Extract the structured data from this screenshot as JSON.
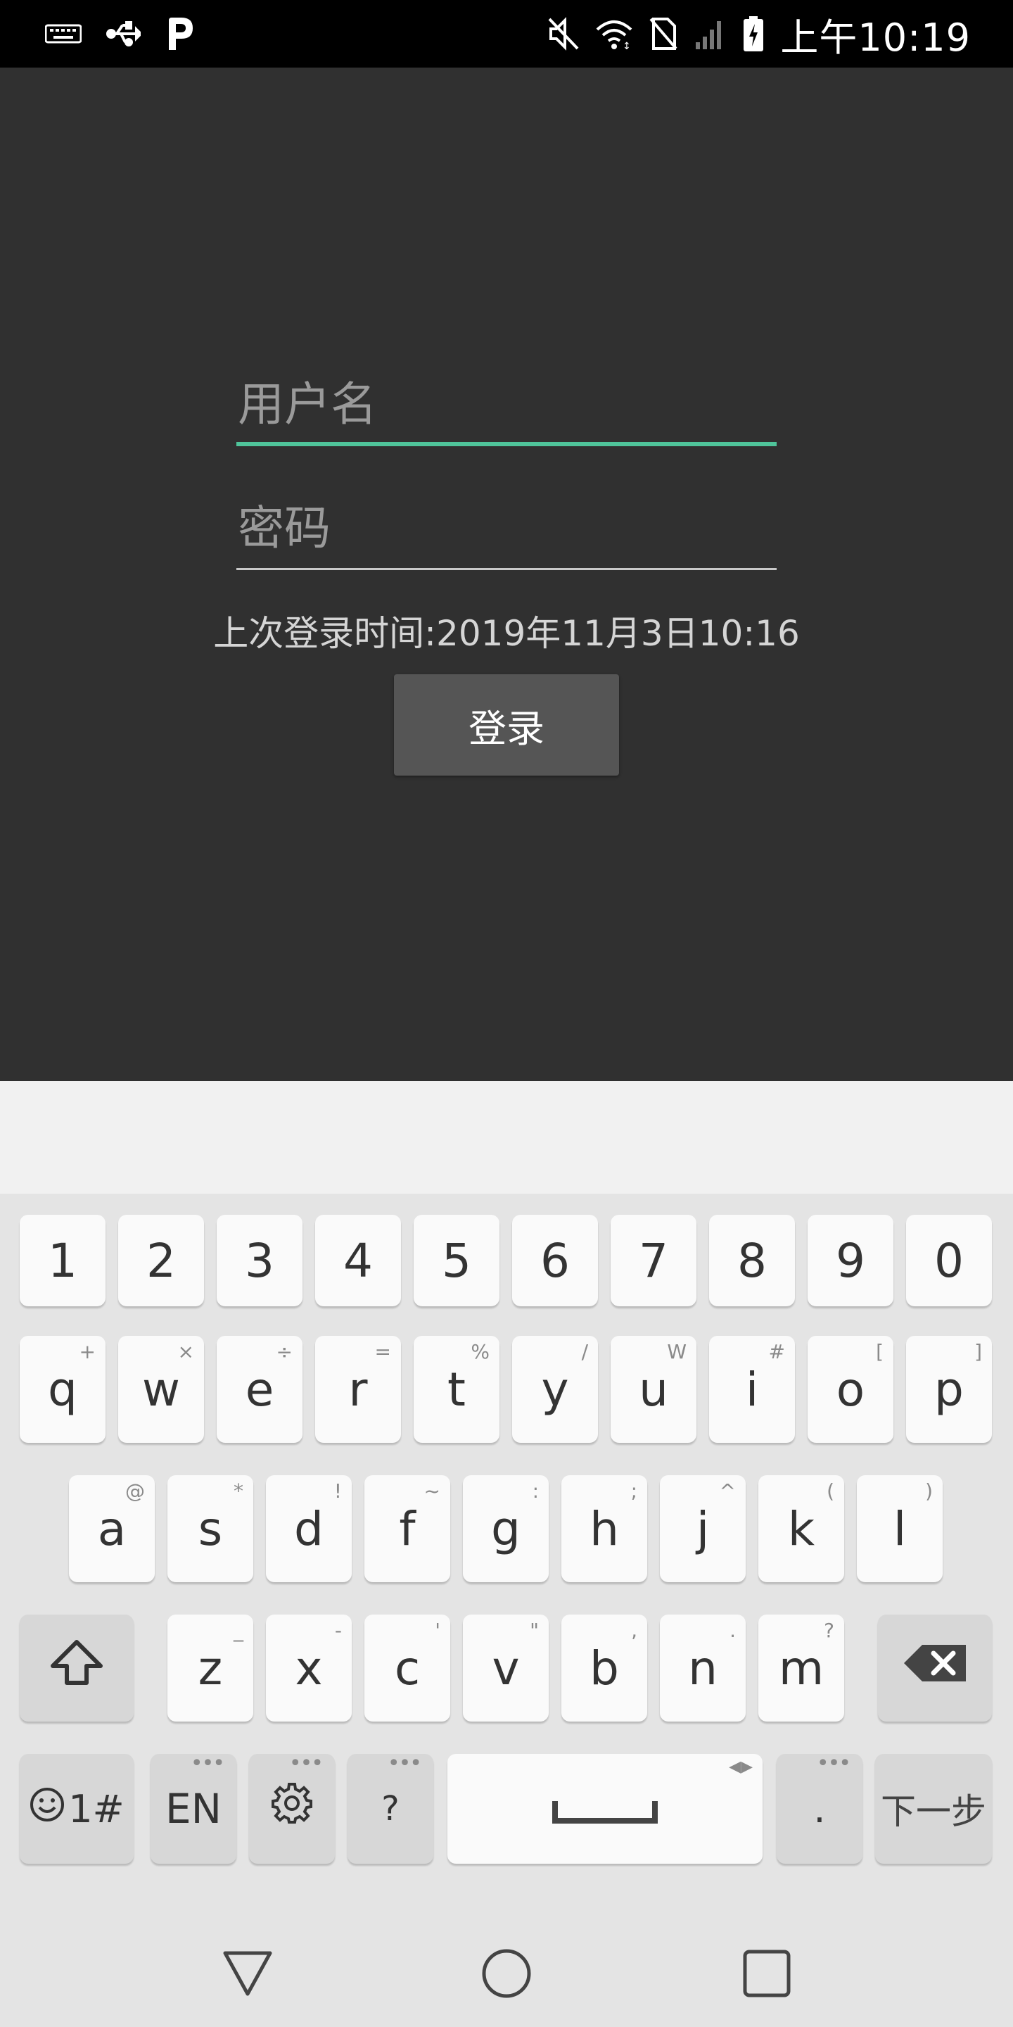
{
  "status_bar": {
    "time": "上午10:19",
    "icons_left": [
      "keyboard-icon",
      "usb-icon",
      "p-icon"
    ],
    "icons_right": [
      "mute-icon",
      "wifi-icon",
      "no-sim-icon",
      "signal-icon",
      "battery-icon"
    ]
  },
  "login": {
    "username_placeholder": "用户名",
    "password_placeholder": "密码",
    "last_login_text": "上次登录时间:2019年11月3日10:16",
    "login_button_label": "登录",
    "accent_color": "#4fc49a"
  },
  "keyboard": {
    "number_row": [
      "1",
      "2",
      "3",
      "4",
      "5",
      "6",
      "7",
      "8",
      "9",
      "0"
    ],
    "row1": [
      {
        "label": "q",
        "hint": "+"
      },
      {
        "label": "w",
        "hint": "×"
      },
      {
        "label": "e",
        "hint": "÷"
      },
      {
        "label": "r",
        "hint": "="
      },
      {
        "label": "t",
        "hint": "%"
      },
      {
        "label": "y",
        "hint": "/"
      },
      {
        "label": "u",
        "hint": "W"
      },
      {
        "label": "i",
        "hint": "#"
      },
      {
        "label": "o",
        "hint": "["
      },
      {
        "label": "p",
        "hint": "]"
      }
    ],
    "row2": [
      {
        "label": "a",
        "hint": "@"
      },
      {
        "label": "s",
        "hint": "*"
      },
      {
        "label": "d",
        "hint": "!"
      },
      {
        "label": "f",
        "hint": "~"
      },
      {
        "label": "g",
        "hint": ":"
      },
      {
        "label": "h",
        "hint": ";"
      },
      {
        "label": "j",
        "hint": "^"
      },
      {
        "label": "k",
        "hint": "("
      },
      {
        "label": "l",
        "hint": ")"
      }
    ],
    "row3": [
      {
        "label": "z",
        "hint": "_"
      },
      {
        "label": "x",
        "hint": "-"
      },
      {
        "label": "c",
        "hint": "'"
      },
      {
        "label": "v",
        "hint": "\""
      },
      {
        "label": "b",
        "hint": ","
      },
      {
        "label": "n",
        "hint": "."
      },
      {
        "label": "m",
        "hint": "?"
      }
    ],
    "shift_icon": "shift-icon",
    "backspace_icon": "backspace-icon",
    "bottom": {
      "emoji_label": "1#",
      "lang_label": "EN",
      "settings_icon": "gear-icon",
      "question_label": "?",
      "space_icon": "space-icon",
      "period_label": ".",
      "next_label": "下一步"
    }
  },
  "nav_bar": {
    "icons": [
      "back-triangle-icon",
      "home-circle-icon",
      "recents-square-icon"
    ]
  }
}
